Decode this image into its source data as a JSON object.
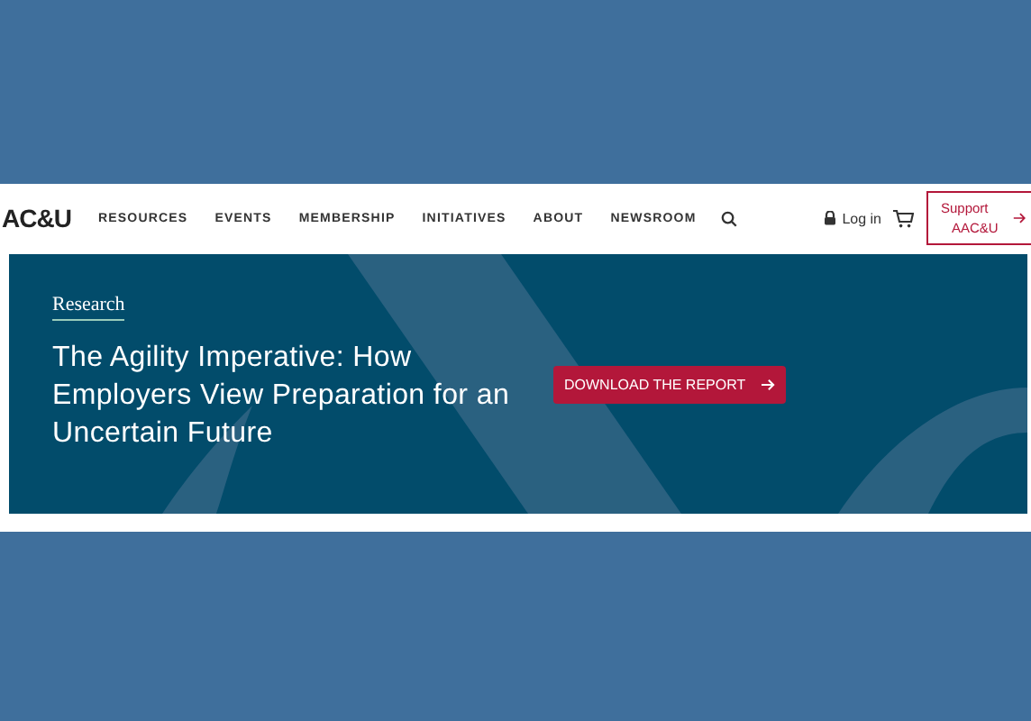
{
  "logo": "AC&U",
  "nav": [
    {
      "label": "RESOURCES"
    },
    {
      "label": "EVENTS"
    },
    {
      "label": "MEMBERSHIP"
    },
    {
      "label": "INITIATIVES"
    },
    {
      "label": "ABOUT"
    },
    {
      "label": "NEWSROOM"
    }
  ],
  "login": "Log in",
  "support": {
    "line1": "Support",
    "line2": "AAC&U"
  },
  "banner": {
    "eyebrow": "Research",
    "title": "The Agility Imperative: How Employers View Preparation for an Uncertain Future",
    "button": "DOWNLOAD THE REPORT"
  }
}
